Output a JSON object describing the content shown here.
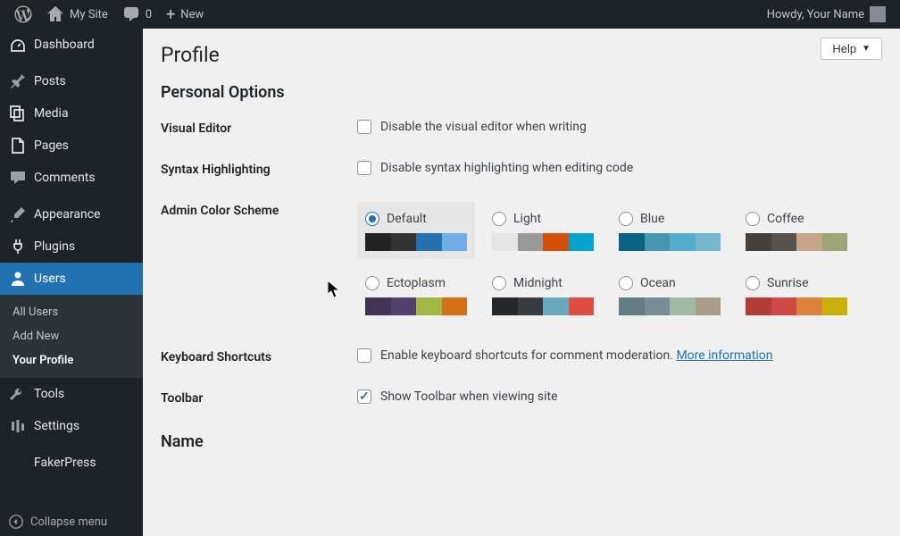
{
  "toolbar": {
    "site_name": "My Site",
    "comments_count": "0",
    "new_label": "New",
    "howdy": "Howdy, Your Name"
  },
  "sidebar": {
    "items": [
      {
        "label": "Dashboard",
        "icon": "dashboard"
      },
      {
        "label": "Posts",
        "icon": "pin"
      },
      {
        "label": "Media",
        "icon": "media"
      },
      {
        "label": "Pages",
        "icon": "pages"
      },
      {
        "label": "Comments",
        "icon": "comment"
      },
      {
        "label": "Appearance",
        "icon": "brush"
      },
      {
        "label": "Plugins",
        "icon": "plug"
      },
      {
        "label": "Users",
        "icon": "user",
        "current": true
      },
      {
        "label": "Tools",
        "icon": "wrench"
      },
      {
        "label": "Settings",
        "icon": "settings"
      },
      {
        "label": "FakerPress",
        "icon": ""
      }
    ],
    "submenu": [
      {
        "label": "All Users"
      },
      {
        "label": "Add New"
      },
      {
        "label": "Your Profile",
        "current": true
      }
    ],
    "collapse_label": "Collapse menu"
  },
  "content": {
    "help_label": "Help",
    "page_title": "Profile",
    "section_personal": "Personal Options",
    "visual_editor": {
      "label": "Visual Editor",
      "checkbox_text": "Disable the visual editor when writing"
    },
    "syntax": {
      "label": "Syntax Highlighting",
      "checkbox_text": "Disable syntax highlighting when editing code"
    },
    "color_scheme": {
      "label": "Admin Color Scheme",
      "schemes": [
        {
          "name": "Default",
          "selected": true,
          "colors": [
            "#222",
            "#333",
            "#2271b1",
            "#72aee6"
          ]
        },
        {
          "name": "Light",
          "selected": false,
          "colors": [
            "#e5e5e5",
            "#999",
            "#d64e07",
            "#04a4cc"
          ]
        },
        {
          "name": "Blue",
          "selected": false,
          "colors": [
            "#096484",
            "#4796b3",
            "#52accc",
            "#74b6ce"
          ]
        },
        {
          "name": "Coffee",
          "selected": false,
          "colors": [
            "#46403c",
            "#59524c",
            "#c7a589",
            "#9ea476"
          ]
        },
        {
          "name": "Ectoplasm",
          "selected": false,
          "colors": [
            "#413256",
            "#523f6d",
            "#a3b745",
            "#d46f15"
          ]
        },
        {
          "name": "Midnight",
          "selected": false,
          "colors": [
            "#25282b",
            "#363b3f",
            "#69a8bb",
            "#e14d43"
          ]
        },
        {
          "name": "Ocean",
          "selected": false,
          "colors": [
            "#627c83",
            "#738e96",
            "#9ebaa0",
            "#aa9d88"
          ]
        },
        {
          "name": "Sunrise",
          "selected": false,
          "colors": [
            "#b43c38",
            "#cf4944",
            "#dd823b",
            "#ccaf0b"
          ]
        }
      ]
    },
    "keyboard": {
      "label": "Keyboard Shortcuts",
      "checkbox_text": "Enable keyboard shortcuts for comment moderation.",
      "link_text": "More information"
    },
    "toolbar_opt": {
      "label": "Toolbar",
      "checkbox_text": "Show Toolbar when viewing site",
      "checked": true
    },
    "section_name": "Name"
  }
}
